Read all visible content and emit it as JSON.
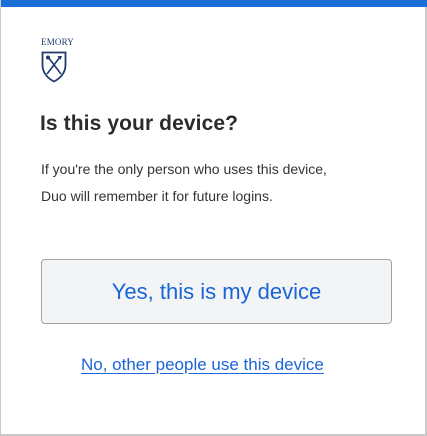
{
  "brand": {
    "name": "EMORY",
    "icon": "shield-icon",
    "color": "#1f3a6b"
  },
  "prompt": {
    "title": "Is this your device?",
    "description_line1": "If you're the only person who uses this device,",
    "description_line2": "Duo will remember it for future logins."
  },
  "actions": {
    "yes_label": "Yes, this is my device",
    "no_label": "No, other people use this device"
  },
  "colors": {
    "accent": "#1c6fd8",
    "link": "#1a64d6",
    "button_bg": "#f3f4f5",
    "text": "#2b2b2b"
  }
}
